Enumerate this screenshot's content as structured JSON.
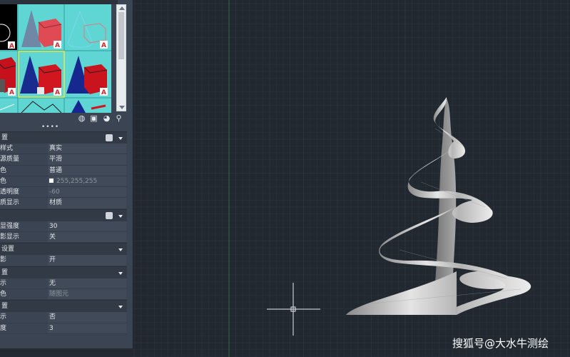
{
  "viewport": {
    "background": "#212830",
    "grid_color": "#2a323c",
    "major_grid_color": "#313a45",
    "axis_color": "#2d6b3d",
    "model_color": "#c8c8c8"
  },
  "tool_palette": {
    "title": "",
    "tiles": [
      {
        "name": "tile-box-outline",
        "icon": "box-wireframe-icon"
      },
      {
        "name": "tile-cone-box-shaded",
        "icon": "cone-box-icon",
        "badge": "A"
      },
      {
        "name": "tile-cone-box-wireframe",
        "icon": "cone-box-wireframe-icon",
        "badge": "A"
      },
      {
        "name": "tile-cube-red",
        "icon": "cube-icon",
        "badge": "A"
      },
      {
        "name": "tile-cone-box-realistic",
        "icon": "cone-box-icon",
        "badge": "A"
      },
      {
        "name": "tile-cone-box-conceptual",
        "icon": "cone-box-icon",
        "badge": "A"
      }
    ],
    "badge_text": "A"
  },
  "properties": {
    "sections": [
      {
        "title": "置",
        "rows": [
          {
            "key": "样式",
            "value": "真实"
          },
          {
            "key": "源质量",
            "value": "平滑"
          },
          {
            "key": "色",
            "value": "普通"
          },
          {
            "key": "色",
            "value": "255,255,255",
            "swatch": "#ffffff",
            "dim": true
          },
          {
            "key": "透明度",
            "value": "-60",
            "dim": true
          },
          {
            "key": "质显示",
            "value": "材质"
          }
        ]
      },
      {
        "title": "",
        "rows": [
          {
            "key": "显强度",
            "value": "30"
          },
          {
            "key": "影显示",
            "value": "关"
          }
        ]
      },
      {
        "title": "设置",
        "rows": [
          {
            "key": "影",
            "value": "开"
          }
        ]
      },
      {
        "title": "置",
        "rows": [
          {
            "key": "示",
            "value": "无"
          },
          {
            "key": "色",
            "value": "随图元",
            "dim": true
          }
        ]
      },
      {
        "title": "置",
        "rows": [
          {
            "key": "示",
            "value": "否"
          },
          {
            "key": "度",
            "value": "3"
          }
        ]
      }
    ]
  },
  "watermark": "搜狐号@大水牛测绘"
}
